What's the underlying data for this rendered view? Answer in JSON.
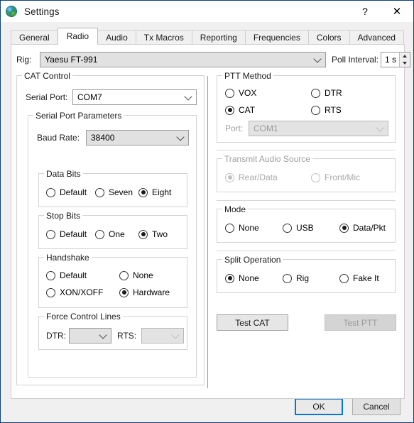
{
  "window": {
    "title": "Settings",
    "icon": "globe-icon",
    "help_glyph": "?",
    "close_glyph": "✕",
    "border_color": "#0f3f77"
  },
  "tabs": [
    {
      "label": "General",
      "active": false
    },
    {
      "label": "Radio",
      "active": true
    },
    {
      "label": "Audio",
      "active": false
    },
    {
      "label": "Tx Macros",
      "active": false
    },
    {
      "label": "Reporting",
      "active": false
    },
    {
      "label": "Frequencies",
      "active": false
    },
    {
      "label": "Colors",
      "active": false
    },
    {
      "label": "Advanced",
      "active": false
    }
  ],
  "rig_row": {
    "rig_label": "Rig:",
    "rig_value": "Yaesu FT-991",
    "poll_label": "Poll Interval:",
    "poll_value": "1 s"
  },
  "cat_control": {
    "title": "CAT Control",
    "serial_port_label": "Serial Port:",
    "serial_port_value": "COM7",
    "serial_params": {
      "title": "Serial Port Parameters",
      "baud_label": "Baud Rate:",
      "baud_value": "38400",
      "data_bits": {
        "title": "Data Bits",
        "options": [
          {
            "label": "Default",
            "checked": false
          },
          {
            "label": "Seven",
            "checked": false
          },
          {
            "label": "Eight",
            "checked": true
          }
        ]
      },
      "stop_bits": {
        "title": "Stop Bits",
        "options": [
          {
            "label": "Default",
            "checked": false
          },
          {
            "label": "One",
            "checked": false
          },
          {
            "label": "Two",
            "checked": true
          }
        ]
      },
      "handshake": {
        "title": "Handshake",
        "options": [
          {
            "label": "Default",
            "checked": false
          },
          {
            "label": "None",
            "checked": false
          },
          {
            "label": "XON/XOFF",
            "checked": false
          },
          {
            "label": "Hardware",
            "checked": true
          }
        ]
      },
      "force_control_lines": {
        "title": "Force Control Lines",
        "dtr_label": "DTR:",
        "dtr_value": "",
        "rts_label": "RTS:",
        "rts_value": ""
      }
    }
  },
  "ptt_method": {
    "title": "PTT Method",
    "options": [
      {
        "label": "VOX",
        "checked": false
      },
      {
        "label": "DTR",
        "checked": false
      },
      {
        "label": "CAT",
        "checked": true
      },
      {
        "label": "RTS",
        "checked": false
      }
    ],
    "port_label": "Port:",
    "port_value": "COM1"
  },
  "transmit_audio_source": {
    "title": "Transmit Audio Source",
    "options": [
      {
        "label": "Rear/Data",
        "checked": true
      },
      {
        "label": "Front/Mic",
        "checked": false
      }
    ]
  },
  "mode": {
    "title": "Mode",
    "options": [
      {
        "label": "None",
        "checked": false
      },
      {
        "label": "USB",
        "checked": false
      },
      {
        "label": "Data/Pkt",
        "checked": true
      }
    ]
  },
  "split_operation": {
    "title": "Split Operation",
    "options": [
      {
        "label": "None",
        "checked": true
      },
      {
        "label": "Rig",
        "checked": false
      },
      {
        "label": "Fake It",
        "checked": false
      }
    ]
  },
  "test_buttons": {
    "test_cat": "Test CAT",
    "test_ptt": "Test PTT"
  },
  "dialog_buttons": {
    "ok": "OK",
    "cancel": "Cancel",
    "accent": "#0078d7"
  }
}
